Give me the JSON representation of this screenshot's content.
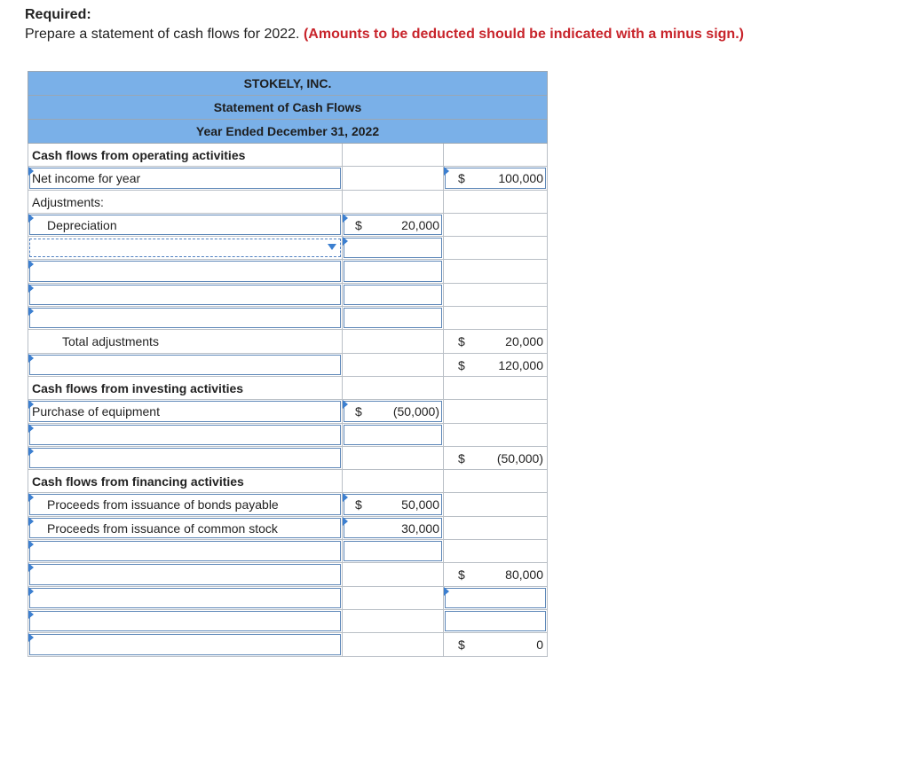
{
  "instructions": {
    "heading": "Required:",
    "text": "Prepare a statement of cash flows for 2022.",
    "note": "(Amounts to be deducted should be indicated with a minus sign.)"
  },
  "statement": {
    "company": "STOKELY, INC.",
    "title": "Statement of Cash Flows",
    "period": "Year Ended December 31, 2022",
    "operating_heading": "Cash flows from operating activities",
    "net_income_label": "Net income for year",
    "net_income_cur": "$",
    "net_income_value": "100,000",
    "adjustments_label": "Adjustments:",
    "depreciation_label": "Depreciation",
    "depreciation_cur": "$",
    "depreciation_value": "20,000",
    "total_adjustments_label": "Total adjustments",
    "total_adjustments_cur": "$",
    "total_adjustments_value": "20,000",
    "net_operating_cur": "$",
    "net_operating_value": "120,000",
    "investing_heading": "Cash flows from investing activities",
    "equipment_label": "Purchase of equipment",
    "equipment_cur": "$",
    "equipment_value": "(50,000)",
    "net_investing_cur": "$",
    "net_investing_value": "(50,000)",
    "financing_heading": "Cash flows from financing activities",
    "bonds_label": "Proceeds from issuance of bonds payable",
    "bonds_cur": "$",
    "bonds_value": "50,000",
    "stock_label": "Proceeds from issuance of common stock",
    "stock_value": "30,000",
    "net_financing_cur": "$",
    "net_financing_value": "80,000",
    "final_cur": "$",
    "final_value": "0"
  }
}
